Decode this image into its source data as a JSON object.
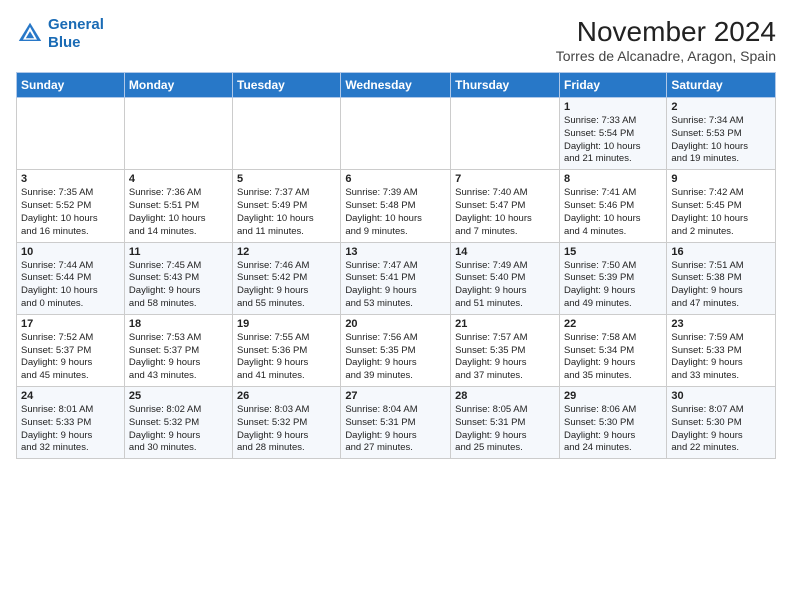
{
  "header": {
    "logo_line1": "General",
    "logo_line2": "Blue",
    "title": "November 2024",
    "subtitle": "Torres de Alcanadre, Aragon, Spain"
  },
  "calendar": {
    "weekdays": [
      "Sunday",
      "Monday",
      "Tuesday",
      "Wednesday",
      "Thursday",
      "Friday",
      "Saturday"
    ],
    "weeks": [
      [
        {
          "day": "",
          "info": ""
        },
        {
          "day": "",
          "info": ""
        },
        {
          "day": "",
          "info": ""
        },
        {
          "day": "",
          "info": ""
        },
        {
          "day": "",
          "info": ""
        },
        {
          "day": "1",
          "info": "Sunrise: 7:33 AM\nSunset: 5:54 PM\nDaylight: 10 hours\nand 21 minutes."
        },
        {
          "day": "2",
          "info": "Sunrise: 7:34 AM\nSunset: 5:53 PM\nDaylight: 10 hours\nand 19 minutes."
        }
      ],
      [
        {
          "day": "3",
          "info": "Sunrise: 7:35 AM\nSunset: 5:52 PM\nDaylight: 10 hours\nand 16 minutes."
        },
        {
          "day": "4",
          "info": "Sunrise: 7:36 AM\nSunset: 5:51 PM\nDaylight: 10 hours\nand 14 minutes."
        },
        {
          "day": "5",
          "info": "Sunrise: 7:37 AM\nSunset: 5:49 PM\nDaylight: 10 hours\nand 11 minutes."
        },
        {
          "day": "6",
          "info": "Sunrise: 7:39 AM\nSunset: 5:48 PM\nDaylight: 10 hours\nand 9 minutes."
        },
        {
          "day": "7",
          "info": "Sunrise: 7:40 AM\nSunset: 5:47 PM\nDaylight: 10 hours\nand 7 minutes."
        },
        {
          "day": "8",
          "info": "Sunrise: 7:41 AM\nSunset: 5:46 PM\nDaylight: 10 hours\nand 4 minutes."
        },
        {
          "day": "9",
          "info": "Sunrise: 7:42 AM\nSunset: 5:45 PM\nDaylight: 10 hours\nand 2 minutes."
        }
      ],
      [
        {
          "day": "10",
          "info": "Sunrise: 7:44 AM\nSunset: 5:44 PM\nDaylight: 10 hours\nand 0 minutes."
        },
        {
          "day": "11",
          "info": "Sunrise: 7:45 AM\nSunset: 5:43 PM\nDaylight: 9 hours\nand 58 minutes."
        },
        {
          "day": "12",
          "info": "Sunrise: 7:46 AM\nSunset: 5:42 PM\nDaylight: 9 hours\nand 55 minutes."
        },
        {
          "day": "13",
          "info": "Sunrise: 7:47 AM\nSunset: 5:41 PM\nDaylight: 9 hours\nand 53 minutes."
        },
        {
          "day": "14",
          "info": "Sunrise: 7:49 AM\nSunset: 5:40 PM\nDaylight: 9 hours\nand 51 minutes."
        },
        {
          "day": "15",
          "info": "Sunrise: 7:50 AM\nSunset: 5:39 PM\nDaylight: 9 hours\nand 49 minutes."
        },
        {
          "day": "16",
          "info": "Sunrise: 7:51 AM\nSunset: 5:38 PM\nDaylight: 9 hours\nand 47 minutes."
        }
      ],
      [
        {
          "day": "17",
          "info": "Sunrise: 7:52 AM\nSunset: 5:37 PM\nDaylight: 9 hours\nand 45 minutes."
        },
        {
          "day": "18",
          "info": "Sunrise: 7:53 AM\nSunset: 5:37 PM\nDaylight: 9 hours\nand 43 minutes."
        },
        {
          "day": "19",
          "info": "Sunrise: 7:55 AM\nSunset: 5:36 PM\nDaylight: 9 hours\nand 41 minutes."
        },
        {
          "day": "20",
          "info": "Sunrise: 7:56 AM\nSunset: 5:35 PM\nDaylight: 9 hours\nand 39 minutes."
        },
        {
          "day": "21",
          "info": "Sunrise: 7:57 AM\nSunset: 5:35 PM\nDaylight: 9 hours\nand 37 minutes."
        },
        {
          "day": "22",
          "info": "Sunrise: 7:58 AM\nSunset: 5:34 PM\nDaylight: 9 hours\nand 35 minutes."
        },
        {
          "day": "23",
          "info": "Sunrise: 7:59 AM\nSunset: 5:33 PM\nDaylight: 9 hours\nand 33 minutes."
        }
      ],
      [
        {
          "day": "24",
          "info": "Sunrise: 8:01 AM\nSunset: 5:33 PM\nDaylight: 9 hours\nand 32 minutes."
        },
        {
          "day": "25",
          "info": "Sunrise: 8:02 AM\nSunset: 5:32 PM\nDaylight: 9 hours\nand 30 minutes."
        },
        {
          "day": "26",
          "info": "Sunrise: 8:03 AM\nSunset: 5:32 PM\nDaylight: 9 hours\nand 28 minutes."
        },
        {
          "day": "27",
          "info": "Sunrise: 8:04 AM\nSunset: 5:31 PM\nDaylight: 9 hours\nand 27 minutes."
        },
        {
          "day": "28",
          "info": "Sunrise: 8:05 AM\nSunset: 5:31 PM\nDaylight: 9 hours\nand 25 minutes."
        },
        {
          "day": "29",
          "info": "Sunrise: 8:06 AM\nSunset: 5:30 PM\nDaylight: 9 hours\nand 24 minutes."
        },
        {
          "day": "30",
          "info": "Sunrise: 8:07 AM\nSunset: 5:30 PM\nDaylight: 9 hours\nand 22 minutes."
        }
      ]
    ]
  }
}
